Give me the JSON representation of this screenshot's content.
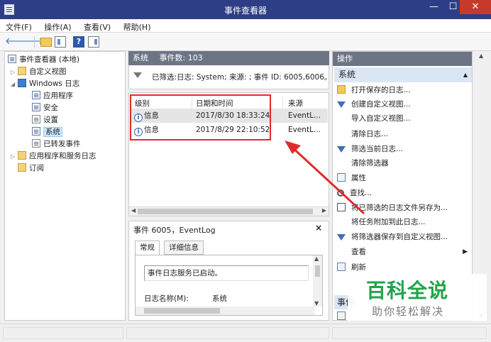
{
  "window": {
    "title": "事件查看器",
    "min": "—",
    "max": "☐",
    "close": "✕"
  },
  "menu": [
    "文件(F)",
    "操作(A)",
    "查看(V)",
    "帮助(H)"
  ],
  "toolbar": {
    "back": "🡐",
    "forward": "🡒",
    "help": "?"
  },
  "tree": {
    "root": "事件查看器 (本地)",
    "custom_views": "自定义视图",
    "windows_logs": "Windows 日志",
    "application": "应用程序",
    "security": "安全",
    "setup": "设置",
    "system": "系统",
    "forwarded": "已转发事件",
    "apps_services": "应用程序和服务日志",
    "subscriptions": "订阅"
  },
  "middle": {
    "log_name": "系统",
    "event_count": "事件数: 103",
    "filter_text": "已筛选:日志: System; 来源: ; 事件 ID: 6005,6006。事",
    "columns": [
      "级别",
      "日期和时间",
      "来源"
    ],
    "rows": [
      {
        "level": "信息",
        "datetime": "2017/8/30 18:33:24",
        "source": "EventL..."
      },
      {
        "level": "信息",
        "datetime": "2017/8/29 22:10:52",
        "source": "EventL..."
      }
    ]
  },
  "detail": {
    "title": "事件 6005，EventLog",
    "close": "×",
    "tabs": [
      "常规",
      "详细信息"
    ],
    "message": "事件日志服务已启动。",
    "log_name_label": "日志名称(M):",
    "log_name_value": "系统"
  },
  "actions": {
    "header": "操作",
    "section": "系统",
    "items": [
      "打开保存的日志...",
      "创建自定义视图...",
      "导入自定义视图...",
      "清除日志...",
      "筛选当前日志...",
      "清除筛选器",
      "属性",
      "查找...",
      "将已筛选的日志文件另存为...",
      "将任务附加到此日志...",
      "将筛选器保存到自定义视图...",
      "查看",
      "刷新"
    ],
    "section2": "事件"
  },
  "watermark": {
    "main": "百科全说",
    "sub": "助你轻松解决"
  },
  "colors": {
    "titlebar": "#2e3e86",
    "pane_header": "#6d7585",
    "annotation_red": "#e02b2b",
    "watermark_green": "#21a34a"
  }
}
